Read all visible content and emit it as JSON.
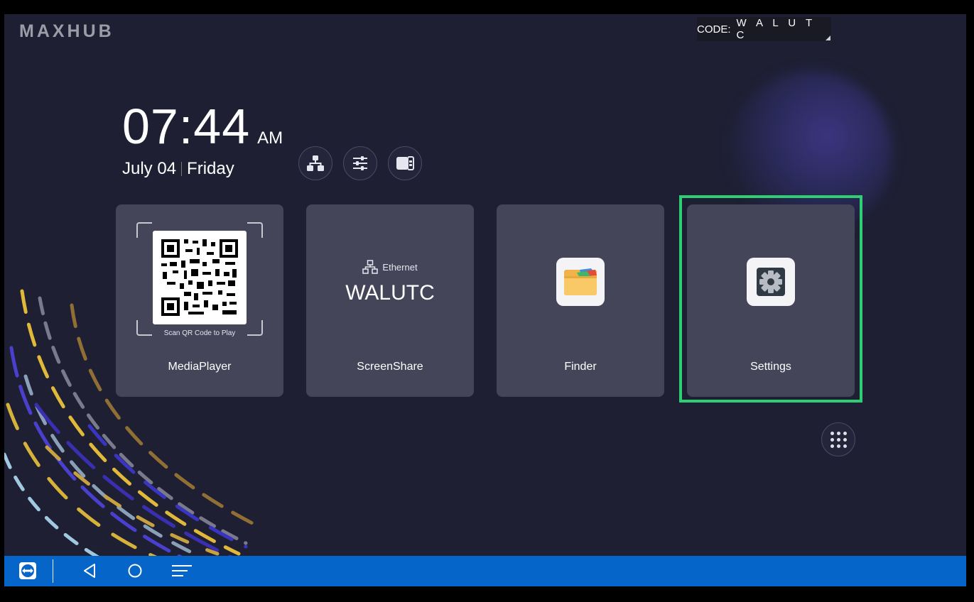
{
  "brand": "MAXHUB",
  "code_box": {
    "label": "CODE:",
    "value": "W A L U T C"
  },
  "clock": {
    "time": "07:44",
    "ampm": "AM",
    "date": "July 04",
    "weekday": "Friday"
  },
  "quick_buttons": [
    {
      "name": "network",
      "icon": "network-icon"
    },
    {
      "name": "adjust",
      "icon": "sliders-icon"
    },
    {
      "name": "source",
      "icon": "source-switch-icon"
    }
  ],
  "tiles": {
    "mediaplayer": {
      "label": "MediaPlayer",
      "qr_caption": "Scan QR Code to Play"
    },
    "screenshare": {
      "label": "ScreenShare",
      "network": "Ethernet",
      "name": "WALUTC"
    },
    "finder": {
      "label": "Finder",
      "icon": "folder-icon"
    },
    "settings": {
      "label": "Settings",
      "icon": "gear-icon"
    }
  },
  "highlight_color": "#2ecf73",
  "taskbar": {
    "color": "#0565c8",
    "buttons": [
      "teamviewer-icon",
      "back-icon",
      "home-icon",
      "recents-icon"
    ]
  }
}
